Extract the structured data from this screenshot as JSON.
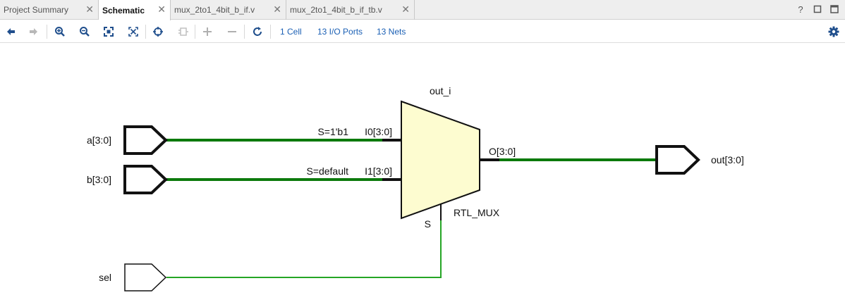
{
  "tabs": [
    {
      "label": "Project Summary",
      "active": false
    },
    {
      "label": "Schematic",
      "active": true
    },
    {
      "label": "mux_2to1_4bit_b_if.v",
      "active": false
    },
    {
      "label": "mux_2to1_4bit_b_if_tb.v",
      "active": false
    }
  ],
  "tab_close_glyph": "✕",
  "window_controls": {
    "help": "?",
    "restore": "□",
    "maximize": "⬜"
  },
  "toolbar": {
    "icons": [
      "back-arrow-icon",
      "forward-arrow-icon",
      "zoom-in-icon",
      "zoom-out-icon",
      "zoom-fit-icon",
      "zoom-area-icon",
      "select-icon",
      "route-icon",
      "expand-icon",
      "collapse-icon",
      "refresh-icon",
      "gear-icon"
    ],
    "cells_link": "1 Cell",
    "io_ports_link": "13 I/O Ports",
    "nets_link": "13 Nets"
  },
  "schematic": {
    "colors": {
      "bus_net": "#0c7a0c",
      "single_net": "#25a525",
      "mux_fill": "#fdfcd0",
      "port_stroke": "#111111"
    },
    "instance_name": "out_i",
    "cell_type": "RTL_MUX",
    "ports": {
      "a": "a[3:0]",
      "b": "b[3:0]",
      "sel": "sel",
      "out": "out[3:0]"
    },
    "mux_pins": {
      "i0": "I0[3:0]",
      "i1": "I1[3:0]",
      "o": "O[3:0]",
      "s": "S"
    },
    "mux_conditions": {
      "i0": "S=1'b1",
      "i1": "S=default"
    }
  }
}
